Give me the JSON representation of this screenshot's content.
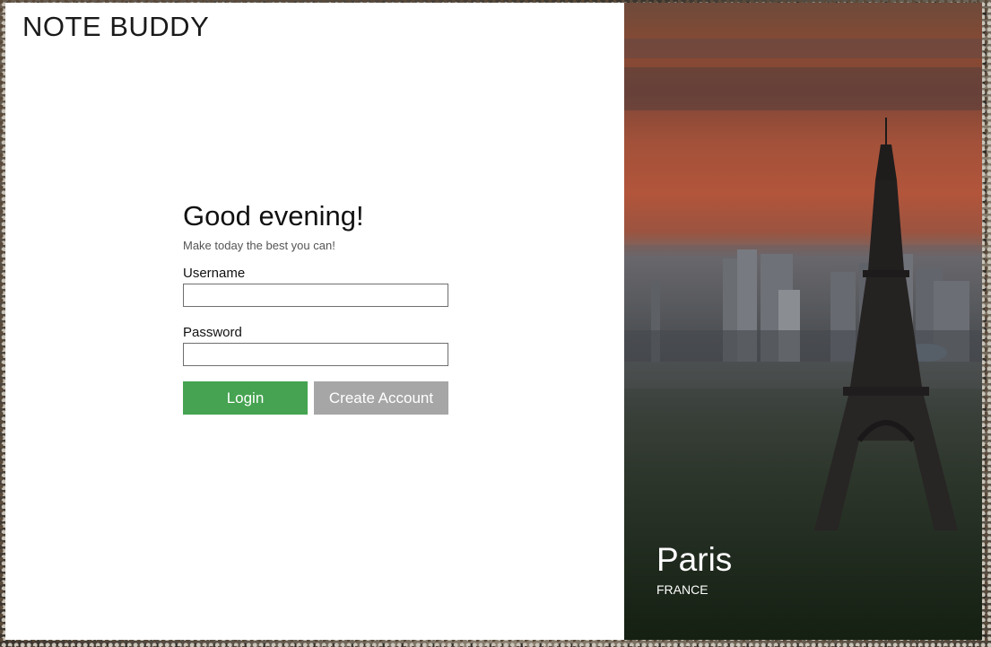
{
  "app": {
    "title": "NOTE BUDDY"
  },
  "login": {
    "greeting": "Good evening!",
    "tagline": "Make today the best you can!",
    "username_label": "Username",
    "username_value": "",
    "password_label": "Password",
    "password_value": "",
    "login_button": "Login",
    "create_account_button": "Create Account"
  },
  "location": {
    "city": "Paris",
    "country": "FRANCE"
  },
  "colors": {
    "login_button": "#45a351",
    "create_account_button": "#a6a6a6",
    "panel_background": "#ffffff",
    "text": "#111111"
  },
  "icons": {
    "background_photo": "eiffel-tower-photo"
  }
}
